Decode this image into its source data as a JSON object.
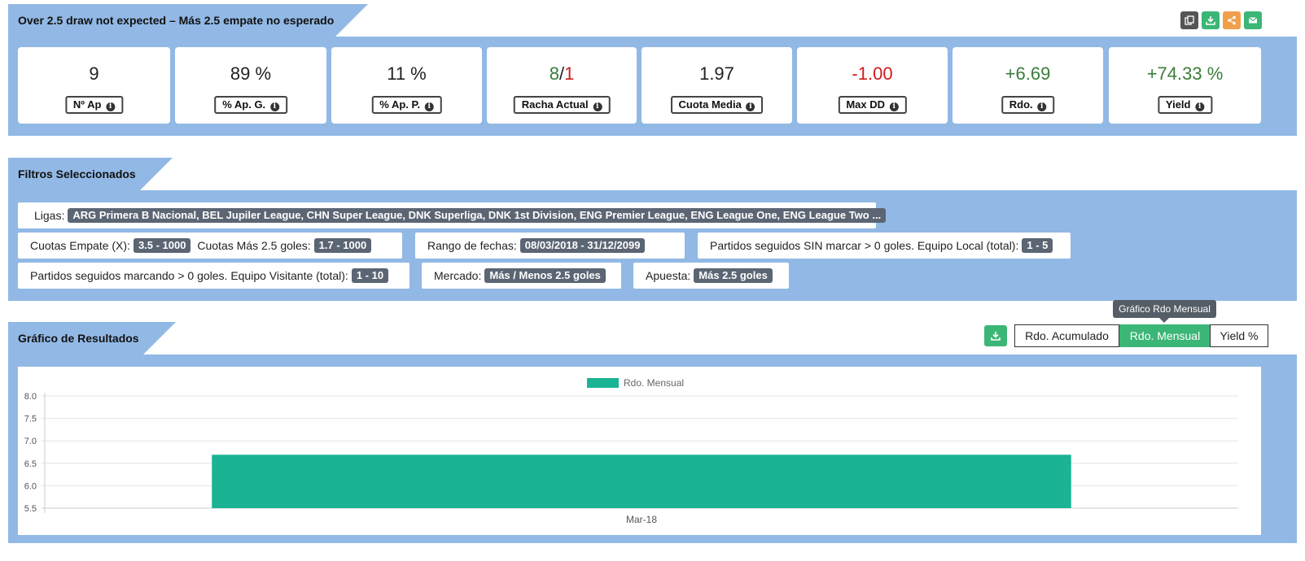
{
  "header": {
    "title": "Over 2.5 draw not expected – Más 2.5 empate no esperado",
    "icons": [
      {
        "name": "copy-icon",
        "color": "#555555"
      },
      {
        "name": "download-icon",
        "color": "#3bb676"
      },
      {
        "name": "share-icon",
        "color": "#f0a04b"
      },
      {
        "name": "mail-icon",
        "color": "#3bb676"
      }
    ]
  },
  "stats": [
    {
      "value": "9",
      "label": "Nº Ap"
    },
    {
      "value": "89 %",
      "label": "% Ap. G."
    },
    {
      "value": "11 %",
      "label": "% Ap. P."
    },
    {
      "value_green": "8",
      "value_sep": "/",
      "value_red": "1",
      "label": "Racha Actual"
    },
    {
      "value": "1.97",
      "label": "Cuota Media"
    },
    {
      "value": "-1.00",
      "label": "Max DD"
    },
    {
      "value": "+6.69",
      "label": "Rdo."
    },
    {
      "value": "+74.33 %",
      "label": "Yield"
    }
  ],
  "filters": {
    "title": "Filtros Seleccionados",
    "ligas_label": "Ligas:",
    "ligas_value": "ARG Primera B Nacional, BEL Jupiler League, CHN Super League, DNK Superliga, DNK 1st Division, ENG Premier League, ENG League One, ENG League Two ...",
    "cuotas_empate_label": "Cuotas Empate (X):",
    "cuotas_empate_value": "3.5 - 1000",
    "cuotas_mas_label": "Cuotas Más 2.5 goles:",
    "cuotas_mas_value": "1.7 - 1000",
    "rango_label": "Rango de fechas:",
    "rango_value": "08/03/2018 - 31/12/2099",
    "sin_marcar_label": "Partidos seguidos SIN marcar > 0 goles. Equipo Local (total):",
    "sin_marcar_value": "1 - 5",
    "marcando_label": "Partidos seguidos marcando > 0 goles. Equipo Visitante (total):",
    "marcando_value": "1 - 10",
    "mercado_label": "Mercado:",
    "mercado_value": "Más / Menos 2.5 goles",
    "apuesta_label": "Apuesta:",
    "apuesta_value": "Más 2.5 goles"
  },
  "results": {
    "title": "Gráfico de Resultados",
    "tooltip": "Gráfico Rdo Mensual",
    "tabs": [
      "Rdo. Acumulado",
      "Rdo. Mensual",
      "Yield %"
    ],
    "active_tab": 1
  },
  "chart_data": {
    "type": "bar",
    "categories": [
      "Mar-18"
    ],
    "series": [
      {
        "name": "Rdo. Mensual",
        "values": [
          6.69
        ],
        "color": "#1ab394"
      }
    ],
    "ylim": [
      5.5,
      8.0
    ],
    "yticks": [
      "8.0",
      "7.5",
      "7.0",
      "6.5",
      "6.0",
      "5.5"
    ],
    "grid": true,
    "legend": "top-center"
  }
}
